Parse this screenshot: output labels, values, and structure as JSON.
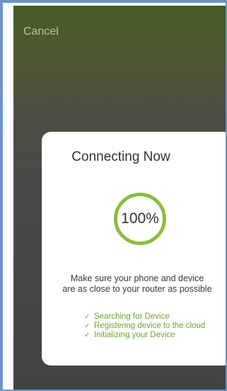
{
  "header": {
    "cancel_label": "Cancel"
  },
  "dialog": {
    "title": "Connecting Now",
    "progress_text": "100%",
    "progress_value": 100,
    "message_line1": "Make sure your phone and device",
    "message_line2": "are as close to your router as possible",
    "steps": [
      {
        "label": "Searching for Device",
        "icon": "check-icon"
      },
      {
        "label": "Registering device to the cloud",
        "icon": "check-icon"
      },
      {
        "label": "Initializing your Device",
        "icon": "check-icon"
      }
    ]
  },
  "colors": {
    "accent": "#8cbd3f",
    "step_text": "#6aa52f",
    "frame_border": "#6f93c7"
  }
}
